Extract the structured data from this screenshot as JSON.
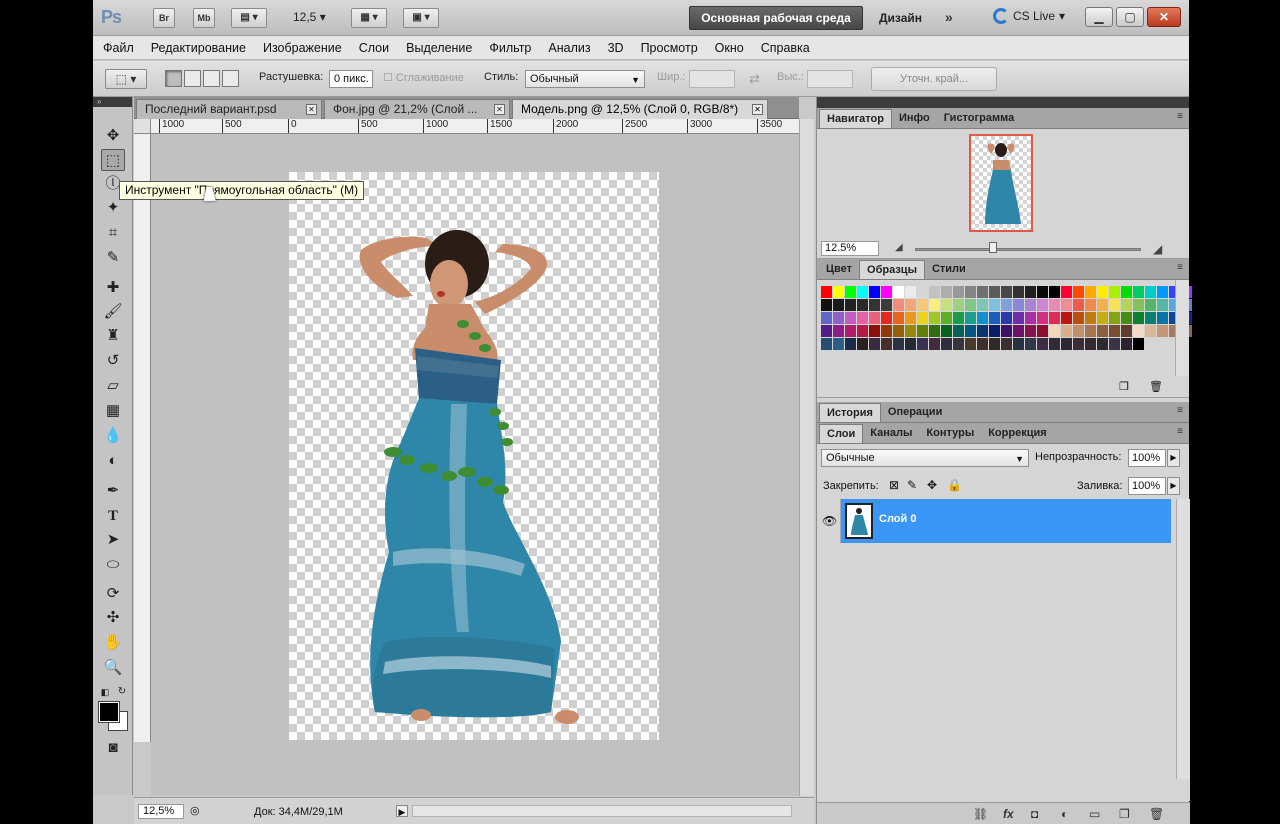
{
  "appbar": {
    "logo": "Ps",
    "btn_br": "Br",
    "btn_mb": "Mb",
    "zoom": "12,5",
    "workspace_active": "Основная рабочая среда",
    "workspace_design": "Дизайн",
    "more": "»",
    "cs_live": "CS Live"
  },
  "menu": [
    "Файл",
    "Редактирование",
    "Изображение",
    "Слои",
    "Выделение",
    "Фильтр",
    "Анализ",
    "3D",
    "Просмотр",
    "Окно",
    "Справка"
  ],
  "options": {
    "feather_label": "Растушевка:",
    "feather_value": "0 пикс.",
    "antialias_label": "Сглаживание",
    "style_label": "Стиль:",
    "style_value": "Обычный",
    "width_label": "Шир.:",
    "height_label": "Выс.:",
    "refine_edge": "Уточн. край..."
  },
  "tabs": [
    {
      "label": "Последний вариант.psd",
      "active": false
    },
    {
      "label": "Фон.jpg @ 21,2% (Слой ...",
      "active": false
    },
    {
      "label": "Модель.png @ 12,5% (Слой 0, RGB/8*)",
      "active": true
    }
  ],
  "ruler": [
    "1000",
    "500",
    "0",
    "500",
    "1000",
    "1500",
    "2000",
    "2500",
    "3000",
    "3500"
  ],
  "tooltip": "Инструмент \"Прямоугольная область\" (M)",
  "status": {
    "zoom": "12,5%",
    "doc": "Док: 34,4M/29,1M"
  },
  "navigator": {
    "tabs": [
      "Навигатор",
      "Инфо",
      "Гистограмма"
    ],
    "zoom": "12.5%"
  },
  "swatches": {
    "tabs": [
      "Цвет",
      "Образцы",
      "Стили"
    ],
    "colors": [
      "#ff0000",
      "#ffff00",
      "#00ff00",
      "#00ffff",
      "#0000ff",
      "#ff00ff",
      "#ffffff",
      "#ebebeb",
      "#d6d6d6",
      "#c2c2c2",
      "#adadad",
      "#999999",
      "#858585",
      "#707070",
      "#5c5c5c",
      "#474747",
      "#333333",
      "#1f1f1f",
      "#0a0a0a",
      "#000000",
      "#ff0033",
      "#ff4a00",
      "#ffaa00",
      "#ffee00",
      "#aaee00",
      "#00dd00",
      "#00cc66",
      "#00cccc",
      "#0099ff",
      "#3344ff",
      "#9933ff",
      "#111111",
      "#1a1a1a",
      "#222222",
      "#2a2a2a",
      "#333333",
      "#3b3b3b",
      "#f08c7a",
      "#f2a776",
      "#f5c878",
      "#f7ee7b",
      "#c5e27d",
      "#9fd07f",
      "#7fc68a",
      "#7fc6b7",
      "#7fbfe0",
      "#7fa2dd",
      "#8b86d7",
      "#a985d6",
      "#cf86d2",
      "#ec89b8",
      "#f08c92",
      "#ee5b4c",
      "#f08a4c",
      "#f3b04d",
      "#f6e352",
      "#b5d456",
      "#84c25a",
      "#55b56a",
      "#56b7a7",
      "#55a9d8",
      "#5a82cf",
      "#6466c7",
      "#8f60c6",
      "#c05fc1",
      "#e463a2",
      "#e8627a",
      "#e02b1f",
      "#e3661d",
      "#e79a1d",
      "#ecd31f",
      "#a2c626",
      "#5fae2a",
      "#1d9c47",
      "#1b9e8c",
      "#1290cb",
      "#1b5fb8",
      "#2b38a8",
      "#6b2fa7",
      "#a82fa4",
      "#d52f85",
      "#dc2c57",
      "#b8180f",
      "#bb4f0f",
      "#bf7c0f",
      "#c4ae10",
      "#83a513",
      "#458d17",
      "#0f7f34",
      "#0e8070",
      "#0874a6",
      "#0c4897",
      "#17268a",
      "#521d89",
      "#8a1d86",
      "#b11c6a",
      "#b71a42",
      "#8c0f08",
      "#8f3a08",
      "#936008",
      "#978709",
      "#64800b",
      "#316d0e",
      "#08611f",
      "#076255",
      "#04587f",
      "#073673",
      "#0f1a68",
      "#3c1268",
      "#6a1266",
      "#891150",
      "#8d0f30",
      "#f3d6b8",
      "#d9ae8a",
      "#c29068",
      "#a67652",
      "#8c5f40",
      "#754e34",
      "#5f3e29",
      "#f4d9c6",
      "#dbb69a",
      "#c39679",
      "#a87a5f",
      "#8f634b",
      "#244e73",
      "#2d5e89",
      "#1c2a4a",
      "#2b2020",
      "#3a2a3f",
      "#4a2e2e",
      "#2b3342",
      "#262a35",
      "#3a3150",
      "#412c3d",
      "#2e2e3d",
      "#38343e",
      "#4a3a2d",
      "#3d2f2a",
      "#2f2a2a",
      "#3a3030",
      "#28323e",
      "#2e3848",
      "#3d2c44",
      "#302b38",
      "#2d2633",
      "#3a2f39",
      "#33292e",
      "#2d2b31",
      "#3b3444",
      "#2c2330",
      "#000000"
    ]
  },
  "history": {
    "tabs": [
      "История",
      "Операции"
    ]
  },
  "layers": {
    "tabs": [
      "Слои",
      "Каналы",
      "Контуры",
      "Коррекция"
    ],
    "blend": "Обычные",
    "opacity_label": "Непрозрачность:",
    "opacity": "100%",
    "lock_label": "Закрепить:",
    "fill_label": "Заливка:",
    "fill": "100%",
    "layer_name": "Слой 0"
  }
}
